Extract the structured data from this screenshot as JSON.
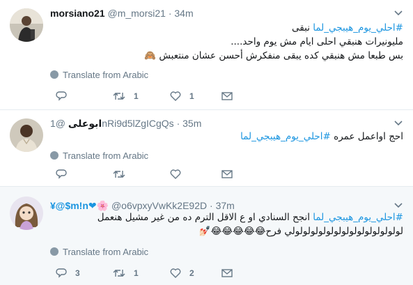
{
  "colors": {
    "accent": "#1b95e0",
    "muted": "#657786",
    "text": "#14171a",
    "divider": "#e6ecf0",
    "hover_bg": "#f5f8fa"
  },
  "translate_label": "Translate from Arabic",
  "tweets": [
    {
      "name": "morsiano21",
      "handle": "@m_morsi21",
      "time": "34m",
      "lines": [
        {
          "hashtag": "#احلي_يوم_هيبجي_لما",
          "text": " نبقى"
        },
        {
          "hashtag": "",
          "text": "مليونيرات هنبقي احلى ايام مش يوم واحد...."
        },
        {
          "hashtag": "",
          "text": "بس طبعا مش هنبقي كده يبقى منفكرش أحسن عشان منتعبش 🙈"
        }
      ],
      "counts": {
        "reply": "",
        "retweet": "1",
        "like": "1"
      }
    },
    {
      "name": "ابوعلى",
      "handle": "@1nRi9d5lZgICgQs",
      "time": "35m",
      "lines": [
        {
          "hashtag": "#احلي_يوم_هيبجي_لما",
          "text": "احج اواعمل عمره "
        }
      ],
      "counts": {
        "reply": "",
        "retweet": "",
        "like": ""
      }
    },
    {
      "name": "¥@$m!n❤🌸",
      "handle": "@o6vpxyVwKk2E92D",
      "time": "37m",
      "lines": [
        {
          "hashtag": "#احلي_يوم_هيبجي_لما",
          "text": " انجح السنادي او ع الاقل الترم ده من غير مشيل هنعمل"
        },
        {
          "hashtag": "",
          "text": "لولولولولولولولولولولولولولولي فرح😂😂😂😂😂💅🏻"
        }
      ],
      "counts": {
        "reply": "3",
        "retweet": "1",
        "like": "2"
      }
    }
  ]
}
